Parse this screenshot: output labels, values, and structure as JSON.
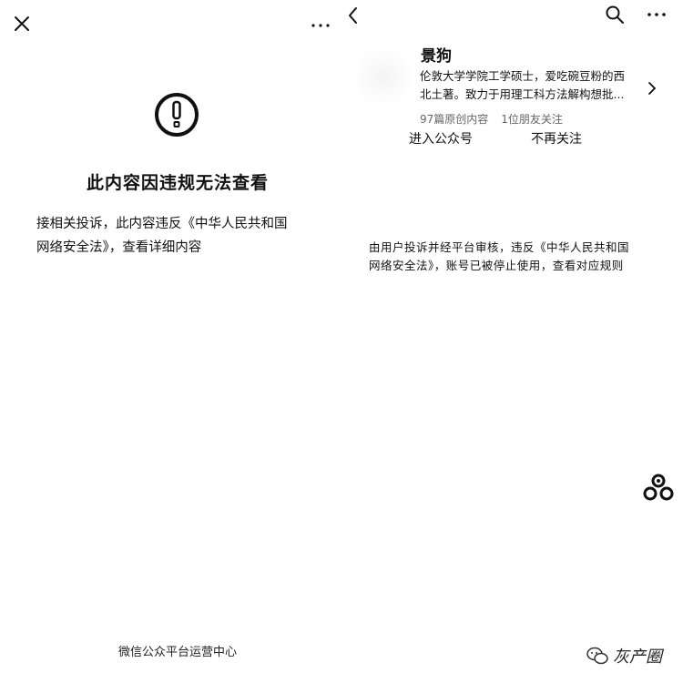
{
  "left": {
    "close_icon": "close-icon",
    "more_icon": "more-icon",
    "warning_icon": "exclamation-circle-icon",
    "title": "此内容因违规无法查看",
    "description_line1": "接相关投诉，此内容违反《中华人民共和国",
    "description_line2_prefix": "网络安全法》，",
    "description_link": "查看详细内容",
    "footer": "微信公众平台运营中心"
  },
  "right": {
    "back_icon": "back-arrow-icon",
    "search_icon": "search-icon",
    "more_icon": "more-icon",
    "account_name": "景狗",
    "intro_line1": "伦敦大学学院工学硕士，爱吃碗豆粉的西",
    "intro_line2": "北土著。致力于用理工科方法解构想批...",
    "stats_articles": "97篇原创内容",
    "stats_friends": "1位朋友关注",
    "enter_label": "进入公众号",
    "unfollow_label": "不再关注",
    "notice_line1": "由用户投诉并经平台审核，违反《中华人民共和国",
    "notice_line2_prefix": "网络安全法》，账号已被停止使用，",
    "notice_link": "查看对应规则",
    "watermark_text": "灰产圈"
  },
  "colors": {
    "text": "#111111",
    "muted": "#666666",
    "background": "#ffffff"
  }
}
